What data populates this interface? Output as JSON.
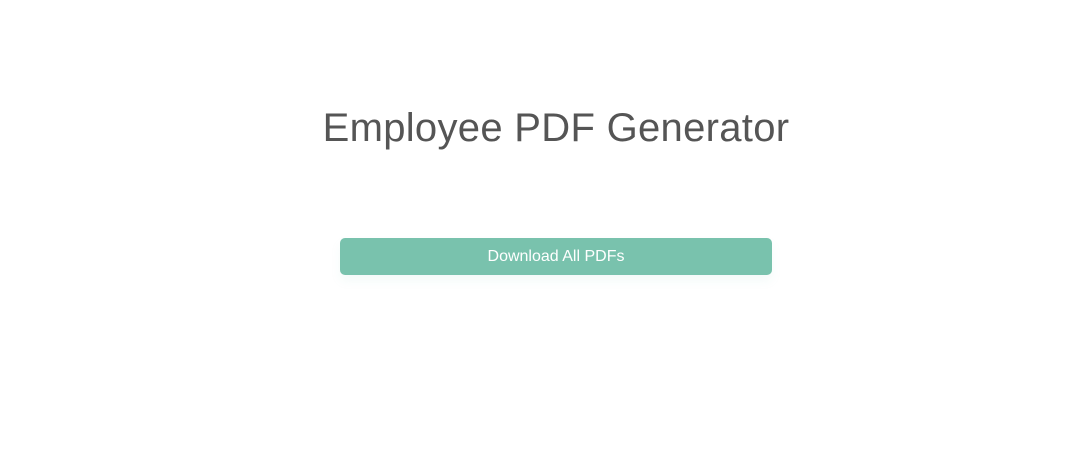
{
  "page": {
    "title": "Employee PDF Generator"
  },
  "actions": {
    "download_all_label": "Download All PDFs"
  },
  "colors": {
    "background": "#ffffff",
    "title_text": "#555555",
    "button_bg": "#79c2ad",
    "button_text": "#ffffff"
  }
}
